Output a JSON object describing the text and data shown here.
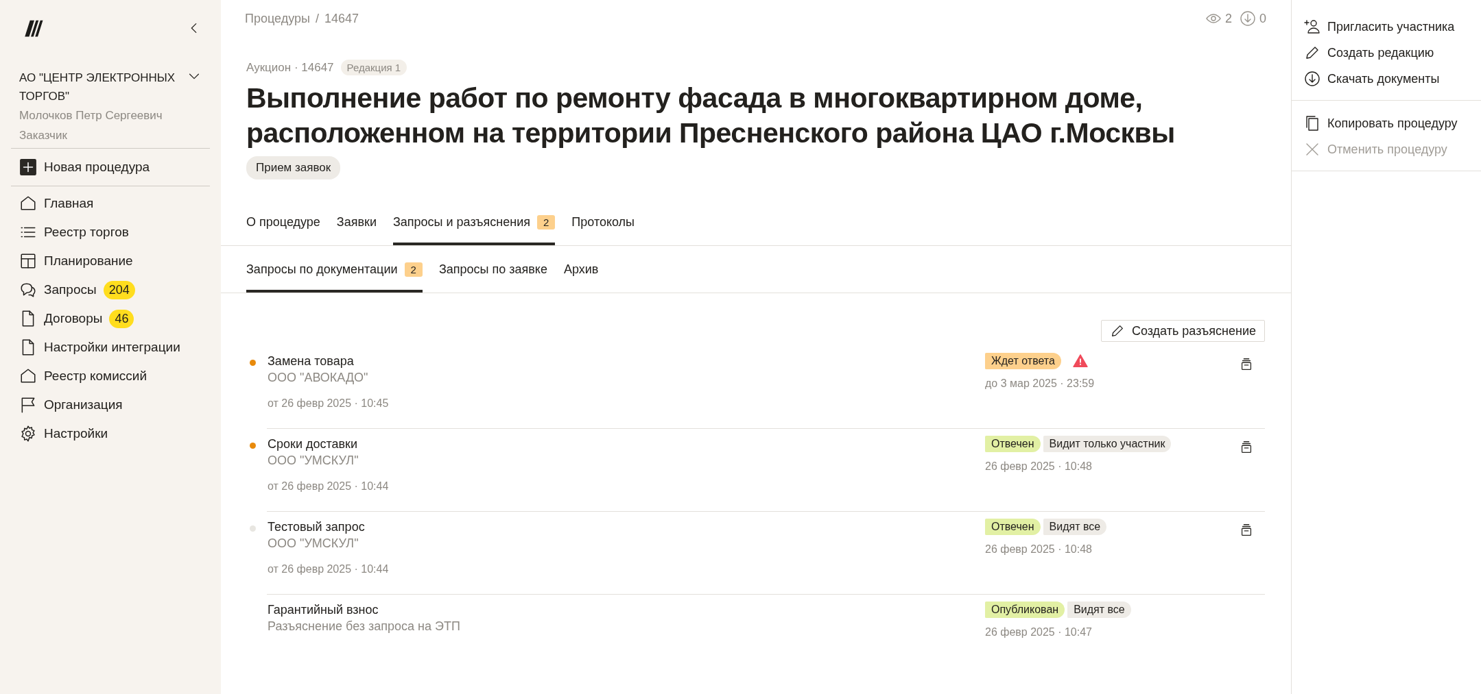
{
  "sidebar": {
    "org": "АО \"ЦЕНТР ЭЛЕКТРОННЫХ ТОРГОВ\"",
    "user": "Молочков Петр Сергеевич",
    "role": "Заказчик",
    "new_button": "Новая процедура",
    "items": [
      {
        "label": "Главная"
      },
      {
        "label": "Реестр торгов"
      },
      {
        "label": "Планирование"
      },
      {
        "label": "Запросы",
        "badge": "204"
      },
      {
        "label": "Договоры",
        "badge": "46"
      },
      {
        "label": "Настройки интеграции"
      },
      {
        "label": "Реестр комиссий"
      },
      {
        "label": "Организация"
      },
      {
        "label": "Настройки"
      }
    ]
  },
  "breadcrumb": [
    "Процедуры",
    "/",
    "14647"
  ],
  "stats": {
    "views": "2",
    "downloads": "0"
  },
  "procedure": {
    "meta": "Аукцион · 14647",
    "edition": "Редакция 1",
    "title": "Выполнение работ по ремонту фасада в многоквартирном доме, расположенном на территории Пресненского района ЦАО г.Москвы",
    "stage": "Прием заявок"
  },
  "tabs": [
    {
      "label": "О процедуре",
      "selected": false
    },
    {
      "label": "Заявки",
      "selected": false
    },
    {
      "label": "Запросы и разъяснения",
      "badge": "2",
      "selected": true
    },
    {
      "label": "Протоколы",
      "selected": false
    }
  ],
  "subtabs": [
    {
      "label": "Запросы по документации",
      "badge": "2",
      "selected": true
    },
    {
      "label": "Запросы по заявке",
      "selected": false
    },
    {
      "label": "Архив",
      "selected": false
    }
  ],
  "create_button": "Создать разъяснение",
  "requests": [
    {
      "kind": "request",
      "unread": true,
      "title": "Замена товара",
      "org": "ООО \"АВОКАДО\"",
      "date": "от 26 февр 2025 · 10:45",
      "tags": [
        {
          "label": "Ждет ответа",
          "color": "#fdd08c"
        }
      ],
      "overdue": true,
      "due": "до 3 мар 2025 · 23:59"
    },
    {
      "kind": "request",
      "unread": true,
      "title": "Сроки доставки",
      "org": "ООО \"УМСКУЛ\"",
      "date": "от 26 февр 2025 · 10:44",
      "tags": [
        {
          "label": "Отвечен",
          "color": "#e2f0a4"
        },
        {
          "label": "Видит только участник",
          "color": "#eeebe6"
        }
      ],
      "overdue": false,
      "due": "26 февр 2025 · 10:48"
    },
    {
      "kind": "request",
      "unread": false,
      "title": "Тестовый запрос",
      "org": "ООО \"УМСКУЛ\"",
      "date": "от 26 февр 2025 · 10:44",
      "tags": [
        {
          "label": "Отвечен",
          "color": "#e2f0a4"
        },
        {
          "label": "Видят все",
          "color": "#eeebe6"
        }
      ],
      "overdue": false,
      "due": "26 февр 2025 · 10:48"
    },
    {
      "kind": "clarification",
      "title": "Гарантийный взнос",
      "org": "Разъяснение без запроса на ЭТП",
      "tags": [
        {
          "label": "Опубликован",
          "color": "#e2f0a4"
        },
        {
          "label": "Видят все",
          "color": "#eeebe6"
        }
      ],
      "overdue": false,
      "due": "26 февр 2025 · 10:47"
    }
  ],
  "actions": [
    {
      "label": "Пригласить участника",
      "disabled": false
    },
    {
      "label": "Создать редакцию",
      "disabled": false
    },
    {
      "label": "Скачать документы",
      "disabled": false
    },
    {
      "label": "Копировать процедуру",
      "disabled": false,
      "group_start": true
    },
    {
      "label": "Отменить процедуру",
      "disabled": true
    }
  ]
}
